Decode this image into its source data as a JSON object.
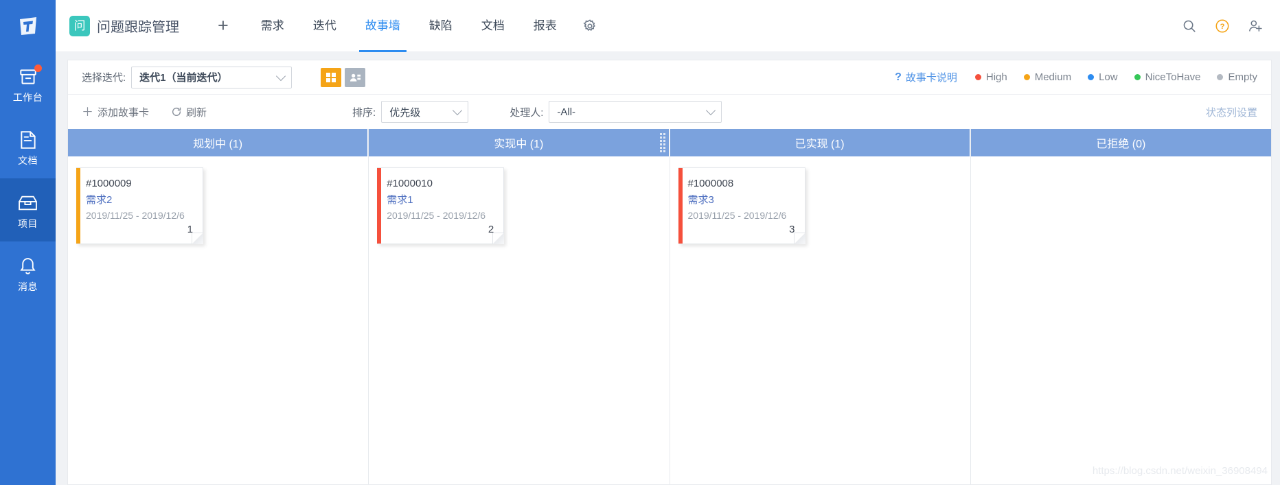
{
  "rail": {
    "logo_icon": "app-logo-icon",
    "items": [
      {
        "label": "工作台",
        "icon": "workbench-icon",
        "active": false,
        "badge": true
      },
      {
        "label": "文档",
        "icon": "document-icon",
        "active": false,
        "badge": false
      },
      {
        "label": "项目",
        "icon": "project-box-icon",
        "active": true,
        "badge": false
      },
      {
        "label": "消息",
        "icon": "bell-icon",
        "active": false,
        "badge": false
      }
    ]
  },
  "header": {
    "project_badge_char": "问",
    "project_name": "问题跟踪管理",
    "add_label": "+",
    "tabs": [
      {
        "label": "需求",
        "active": false
      },
      {
        "label": "迭代",
        "active": false
      },
      {
        "label": "故事墙",
        "active": true
      },
      {
        "label": "缺陷",
        "active": false
      },
      {
        "label": "文档",
        "active": false
      },
      {
        "label": "报表",
        "active": false
      }
    ],
    "gear_icon": "gear-icon",
    "search_icon": "search-icon",
    "help_icon": "help-circle-icon",
    "add_user_icon": "add-user-icon"
  },
  "filters": {
    "iteration_label": "选择迭代:",
    "iteration_value": "迭代1（当前迭代）",
    "view_grid_icon": "grid-view-icon",
    "view_people_icon": "people-view-icon",
    "story_help_label": "故事卡说明",
    "story_help_icon": "question-mark-icon",
    "legend": [
      {
        "label": "High",
        "color": "#f5503c"
      },
      {
        "label": "Medium",
        "color": "#f5a417"
      },
      {
        "label": "Low",
        "color": "#2d8cf0"
      },
      {
        "label": "NiceToHave",
        "color": "#35c758"
      },
      {
        "label": "Empty",
        "color": "#b4bac2"
      }
    ],
    "add_story_label": "添加故事卡",
    "add_story_icon": "plus-icon",
    "refresh_label": "刷新",
    "refresh_icon": "refresh-icon",
    "sort_label": "排序:",
    "sort_value": "优先级",
    "assignee_label": "处理人:",
    "assignee_value": "-All-",
    "status_config_label": "状态列设置"
  },
  "board": {
    "columns": [
      {
        "title": "规划中 (1)",
        "has_grip": false,
        "cards": [
          {
            "id": "#1000009",
            "title": "需求2",
            "dates": "2019/11/25 - 2019/12/6",
            "number": "1",
            "priority_color": "#f5a417"
          }
        ]
      },
      {
        "title": "实现中 (1)",
        "has_grip": true,
        "cards": [
          {
            "id": "#1000010",
            "title": "需求1",
            "dates": "2019/11/25 - 2019/12/6",
            "number": "2",
            "priority_color": "#f5503c"
          }
        ]
      },
      {
        "title": "已实现 (1)",
        "has_grip": false,
        "cards": [
          {
            "id": "#1000008",
            "title": "需求3",
            "dates": "2019/11/25 - 2019/12/6",
            "number": "3",
            "priority_color": "#f5503c"
          }
        ]
      },
      {
        "title": "已拒绝 (0)",
        "has_grip": false,
        "cards": []
      }
    ]
  },
  "watermark": "https://blog.csdn.net/weixin_36908494",
  "colors": {
    "rail_bg": "#2f72d2",
    "rail_active": "#2160b8",
    "accent_blue": "#2d8cf0",
    "column_head": "#7ba2dd",
    "orange": "#f5a417",
    "badge_teal": "#3bc7bd"
  }
}
